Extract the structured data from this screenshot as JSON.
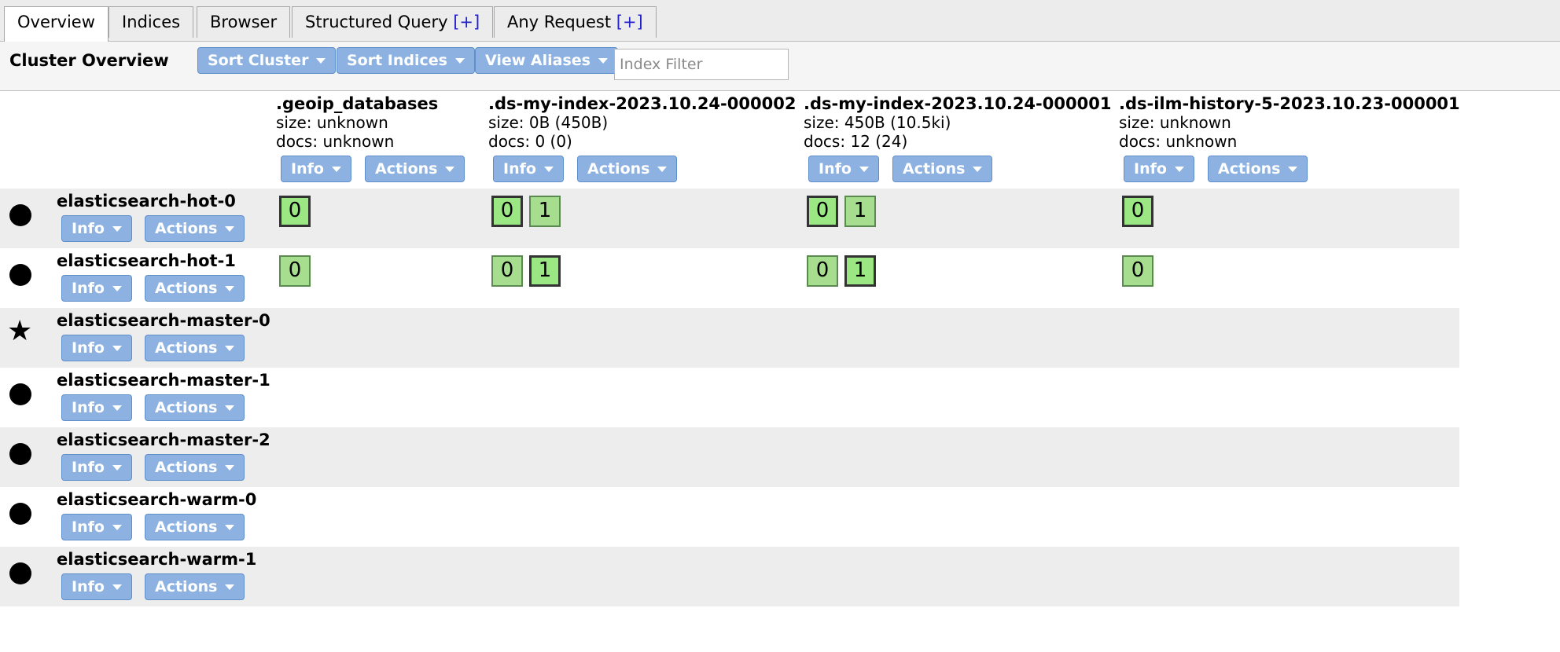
{
  "tabs": [
    {
      "label": "Overview",
      "plus": ""
    },
    {
      "label": "Indices",
      "plus": ""
    },
    {
      "label": "Browser",
      "plus": ""
    },
    {
      "label": "Structured Query ",
      "plus": "[+]"
    },
    {
      "label": "Any Request ",
      "plus": "[+]"
    }
  ],
  "header": {
    "title": "Cluster Overview",
    "sort_cluster": "Sort Cluster",
    "sort_indices": "Sort Indices",
    "view_aliases": "View Aliases",
    "filter_placeholder": "Index Filter"
  },
  "buttons": {
    "info": "Info",
    "actions": "Actions"
  },
  "indices": [
    {
      "name": ".geoip_databases",
      "size": "size: unknown",
      "docs": "docs: unknown"
    },
    {
      "name": ".ds-my-index-2023.10.24-000002",
      "size": "size: 0B (450B)",
      "docs": "docs: 0 (0)"
    },
    {
      "name": ".ds-my-index-2023.10.24-000001",
      "size": "size: 450B (10.5ki)",
      "docs": "docs: 12 (24)"
    },
    {
      "name": ".ds-ilm-history-5-2023.10.23-000001",
      "size": "size: unknown",
      "docs": "docs: unknown"
    }
  ],
  "nodes": [
    {
      "name": "elasticsearch-hot-0",
      "icon": "circle-icon"
    },
    {
      "name": "elasticsearch-hot-1",
      "icon": "circle-icon"
    },
    {
      "name": "elasticsearch-master-0",
      "icon": "star-icon"
    },
    {
      "name": "elasticsearch-master-1",
      "icon": "circle-icon"
    },
    {
      "name": "elasticsearch-master-2",
      "icon": "circle-icon"
    },
    {
      "name": "elasticsearch-warm-0",
      "icon": "circle-icon"
    },
    {
      "name": "elasticsearch-warm-1",
      "icon": "circle-icon"
    }
  ],
  "shards": {
    "hot0": {
      "geoip": "0",
      "idx2_p": "0",
      "idx2_r": "1",
      "idx1_p": "0",
      "idx1_r": "1",
      "ilm": "0"
    },
    "hot1": {
      "geoip": "0",
      "idx2_p": "0",
      "idx2_r": "1",
      "idx1_p": "0",
      "idx1_r": "1",
      "ilm": "0"
    }
  },
  "colors": {
    "button": "#8db2e2",
    "shard": "#a6dd8f",
    "row_shade": "#ededed"
  }
}
